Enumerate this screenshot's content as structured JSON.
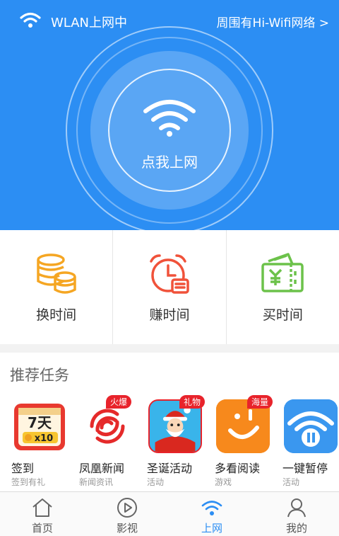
{
  "status_bar": {
    "wlan_text": "WLAN上网中",
    "nearby_text": "周围有Hi-Wifi网络 >"
  },
  "connect": {
    "label": "点我上网"
  },
  "time_actions": [
    {
      "label": "换时间",
      "icon": "coin-stack-icon",
      "color": "#f5a623"
    },
    {
      "label": "赚时间",
      "icon": "alarm-clock-icon",
      "color": "#f0523a"
    },
    {
      "label": "买时间",
      "icon": "ticket-icon",
      "color": "#6cc24a"
    }
  ],
  "tasks": {
    "title": "推荐任务",
    "items": [
      {
        "name": "签到",
        "sub": "签到有礼",
        "badge": "",
        "icon_text": "7天",
        "icon_text2": "x10"
      },
      {
        "name": "凤凰新闻",
        "sub": "新闻资讯",
        "badge": "火爆"
      },
      {
        "name": "圣诞活动",
        "sub": "活动",
        "badge": "礼物"
      },
      {
        "name": "多看阅读",
        "sub": "游戏",
        "badge": "海量"
      },
      {
        "name": "一键暂停",
        "sub": "活动",
        "badge": ""
      }
    ]
  },
  "tabbar": [
    {
      "label": "首页",
      "icon": "home-icon"
    },
    {
      "label": "影视",
      "icon": "play-icon"
    },
    {
      "label": "上网",
      "icon": "wifi-icon",
      "active": true
    },
    {
      "label": "我的",
      "icon": "user-icon"
    }
  ],
  "colors": {
    "primary": "#2c8ef3",
    "badge": "#e8232b"
  }
}
